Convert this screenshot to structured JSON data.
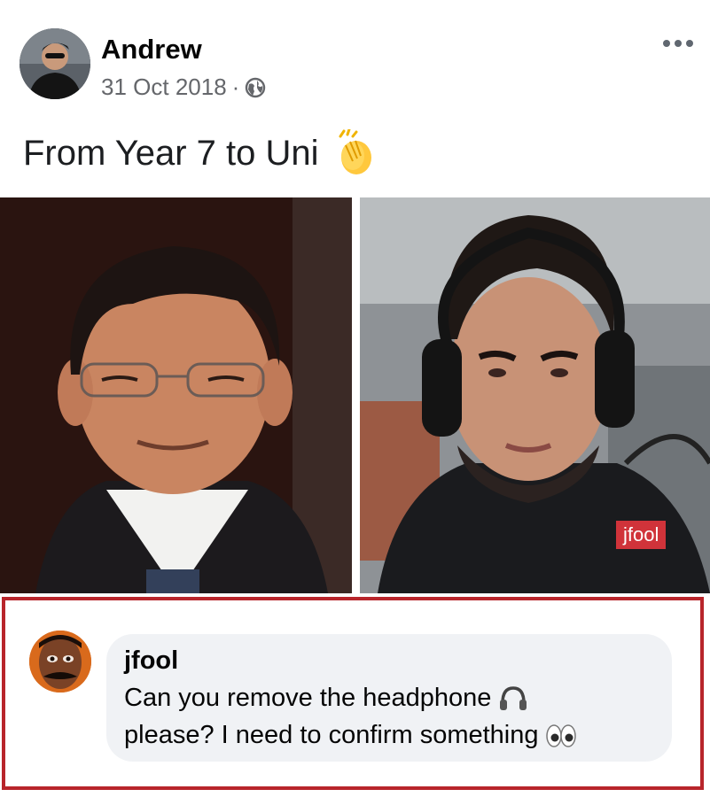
{
  "post": {
    "author": "Andrew",
    "date": "31 Oct 2018",
    "separator": "·",
    "privacy_icon": "globe-icon",
    "text": "From Year 7 to Uni",
    "text_emoji": "clapping-hands-emoji",
    "photos": [
      "school-photo-glasses",
      "adult-selfie-headphones"
    ],
    "watermark": "jfool"
  },
  "comment": {
    "author": "jfool",
    "line1": "Can you remove the headphone",
    "line1_emoji": "headphone-emoji",
    "line2": "please? I need to confirm something",
    "line2_emoji": "eyes-emoji",
    "highlight_color": "#b8252b"
  },
  "colors": {
    "name": "#050505",
    "meta": "#65676b",
    "bubble": "#f0f2f5",
    "watermark_bg": "#d0333a"
  }
}
